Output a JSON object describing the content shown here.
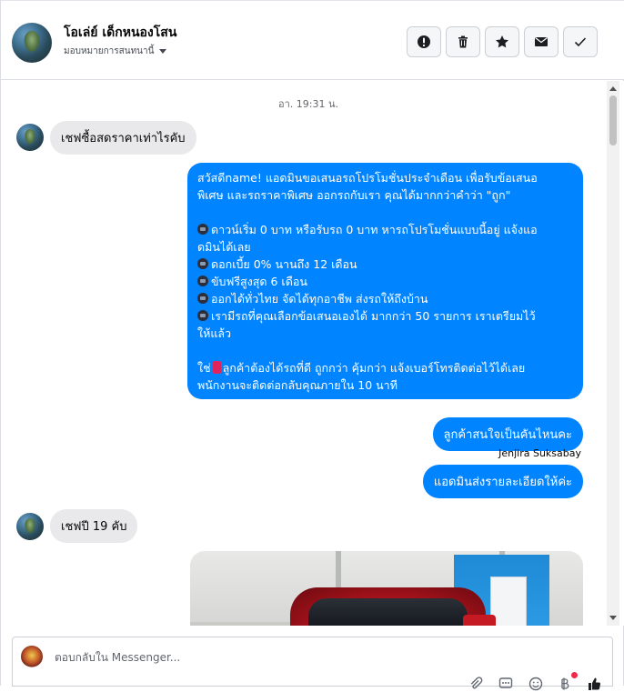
{
  "header": {
    "contact_name": "โอเล่ย์ เด็กหนองโสน",
    "assign_label": "มอบหมายการสนทนานี้",
    "actions": [
      {
        "name": "mark-spam-button",
        "icon": "alert-icon"
      },
      {
        "name": "delete-button",
        "icon": "trash-icon"
      },
      {
        "name": "star-button",
        "icon": "star-icon"
      },
      {
        "name": "mark-unread-button",
        "icon": "envelope-icon"
      },
      {
        "name": "mark-done-button",
        "icon": "check-icon"
      }
    ]
  },
  "conversation": {
    "timestamp": "อา. 19:31 น.",
    "incoming_1": "เชฟซื้อสดราคาเท่าไรคับ",
    "outgoing_promo": {
      "lines": [
        "สวัสดีname! แอดมินขอเสนอรถโปรโมชั่นประจำเดือน เพื่อรับข้อเสนอ",
        "พิเศษ และรถราคาพิเศษ ออกรถกับเรา คุณได้มากกว่าคำว่า \"ถูก\"",
        "",
        "ดาวน์เริ่ม 0 บาท หรือรับรถ 0 บาท หารถโปรโมชั่นแบบนี้อยู่ แจ้งแอ",
        "ดมินได้เลย",
        "ดอกเบี้ย 0% นานถึง 12 เดือน",
        "ขับฟรีสูงสุด 6 เดือน",
        "ออกได้ทั่วไทย จัดได้ทุกอาชีพ ส่งรถให้ถึงบ้าน",
        "เรามีรถที่คุณเลือกข้อเสนอเองได้ มากกว่า 50 รายการ เราเตรียมไว้",
        "ให้แล้ว",
        "",
        "ลูกค้าต้องได้รถที่ดี ถูกกว่า คุ้มกว่า แจ้งเบอร์โทรติดต่อไว้ได้เลย",
        "พนักงานจะติดต่อกลับคุณภายใน 10 นาที"
      ],
      "line3_prefix": "ใช่",
      "bullet_icon": "car-emoji-icon"
    },
    "outgoing_2": "ลูกค้าสนใจเป็นคันไหนคะ",
    "sender_name": "Jenjira Suksabay",
    "outgoing_3": "แอดมินส่งรายละเอียดให้ค่ะ",
    "incoming_2": "เชฟปี 19 คับ"
  },
  "composer": {
    "placeholder": "ตอบกลับใน Messenger..."
  },
  "colors": {
    "outgoing_bubble": "#0084ff",
    "incoming_bubble": "#e9e9eb",
    "notification_dot": "#f02849"
  }
}
